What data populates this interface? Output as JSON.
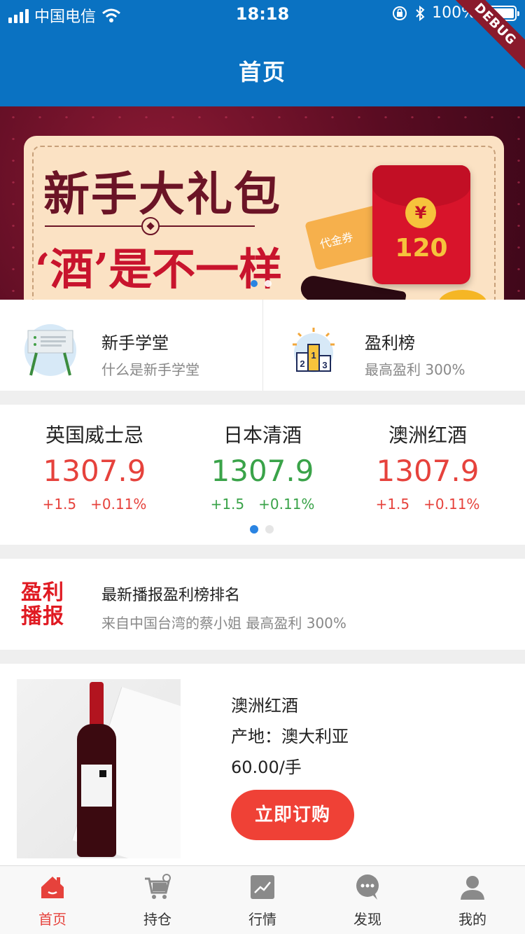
{
  "status": {
    "carrier": "中国电信",
    "time": "18:18",
    "battery": "100%",
    "debug_ribbon": "DEBUG"
  },
  "nav": {
    "title": "首页"
  },
  "banner": {
    "headline": "新手大礼包",
    "slogan": "‘酒’是不一样",
    "voucher_label": "代金券",
    "coin_symbol": "¥",
    "amount": "120",
    "pages": 2,
    "active_page": 0
  },
  "quick": [
    {
      "title": "新手学堂",
      "subtitle": "什么是新手学堂",
      "icon": "presentation-board-icon"
    },
    {
      "title": "盈利榜",
      "subtitle": "最高盈利 300%",
      "icon": "podium-icon"
    }
  ],
  "tickers": [
    {
      "name": "英国威士忌",
      "price": "1307.9",
      "change": "+1.5",
      "change_pct": "+0.11%",
      "color": "#e6423c"
    },
    {
      "name": "日本清酒",
      "price": "1307.9",
      "change": "+1.5",
      "change_pct": "+0.11%",
      "color": "#3aa349"
    },
    {
      "name": "澳洲红酒",
      "price": "1307.9",
      "change": "+1.5",
      "change_pct": "+0.11%",
      "color": "#e6423c"
    }
  ],
  "broadcast": {
    "logo_line1": "盈利",
    "logo_line2": "播报",
    "title": "最新播报盈利榜排名",
    "subtitle": "来自中国台湾的蔡小姐 最高盈利 300%"
  },
  "product": {
    "name": "澳洲红酒",
    "origin": "产地：澳大利亚",
    "price": "60.00/手",
    "buy_label": "立即订购"
  },
  "tabs": [
    {
      "label": "首页",
      "icon": "home-icon",
      "active": true
    },
    {
      "label": "持仓",
      "icon": "cart-icon",
      "active": false
    },
    {
      "label": "行情",
      "icon": "chart-icon",
      "active": false
    },
    {
      "label": "发现",
      "icon": "chat-bubble-icon",
      "active": false
    },
    {
      "label": "我的",
      "icon": "user-icon",
      "active": false
    }
  ],
  "colors": {
    "primary": "#0a72c2",
    "accent_red": "#e6423c",
    "up_green": "#3aa349",
    "buy_button": "#ef4136"
  }
}
